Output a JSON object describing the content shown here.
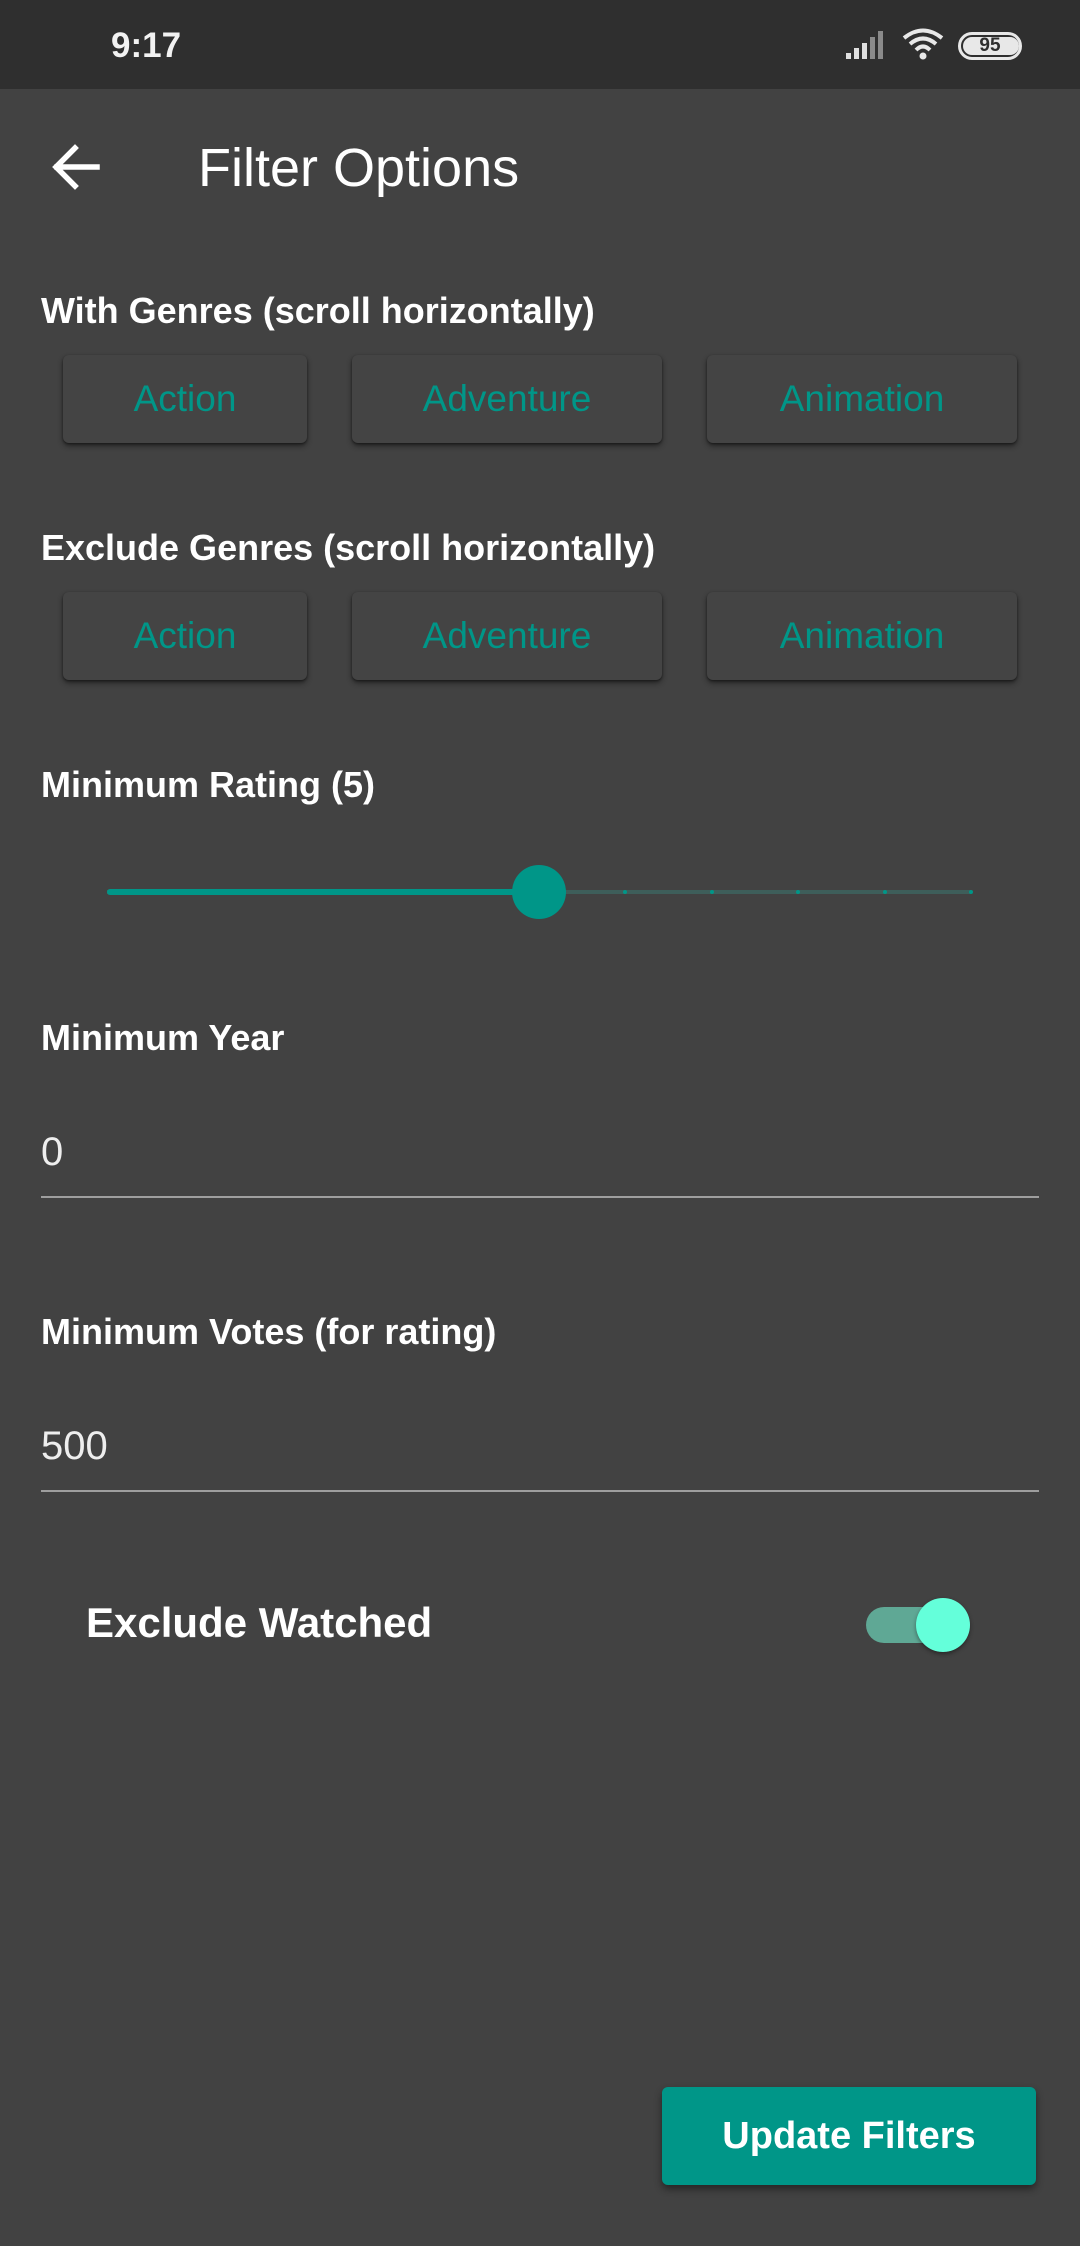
{
  "status_bar": {
    "time": "9:17",
    "battery_level": "95",
    "icons": [
      "signal-icon",
      "wifi-icon",
      "battery-icon"
    ]
  },
  "toolbar": {
    "title": "Filter Options",
    "back_icon": "arrow-left-icon"
  },
  "with_genres": {
    "label": "With Genres (scroll horizontally)",
    "chips": [
      "Action",
      "Adventure",
      "Animation"
    ]
  },
  "exclude_genres": {
    "label": "Exclude Genres (scroll horizontally)",
    "chips": [
      "Action",
      "Adventure",
      "Animation"
    ]
  },
  "min_rating": {
    "label": "Minimum Rating (5)",
    "value": 5,
    "max": 10,
    "step": 1,
    "ticks": 10
  },
  "min_year": {
    "label": "Minimum Year",
    "value": "0"
  },
  "min_votes": {
    "label": "Minimum Votes (for rating)",
    "value": "500"
  },
  "exclude_watched": {
    "label": "Exclude Watched",
    "enabled": true
  },
  "update_button": {
    "label": "Update Filters"
  },
  "colors": {
    "accent": "#009688",
    "switch_thumb": "#64ffda",
    "background": "#424242",
    "status_bar": "#2f2f2f"
  }
}
